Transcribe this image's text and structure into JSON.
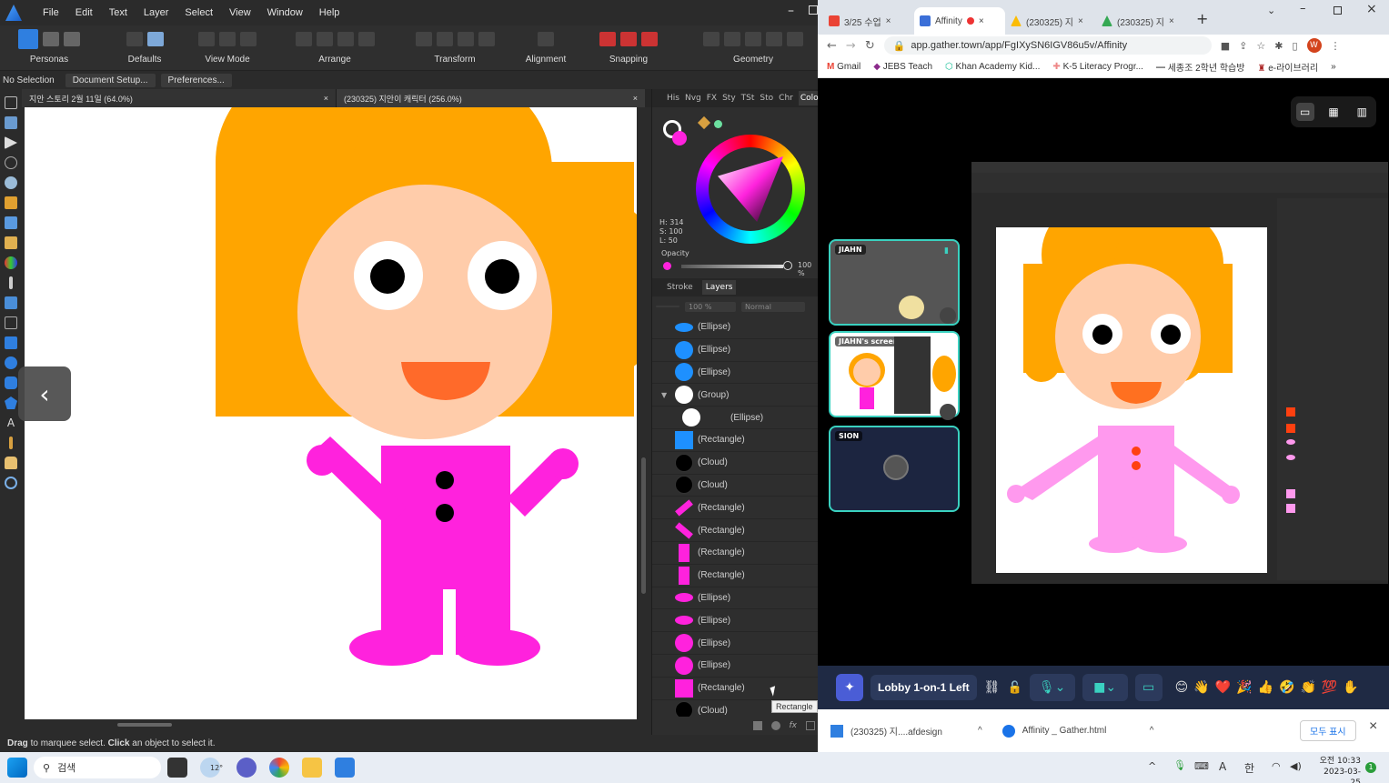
{
  "affinity": {
    "menu": [
      "File",
      "Edit",
      "Text",
      "Layer",
      "Select",
      "View",
      "Window",
      "Help"
    ],
    "toolbar": {
      "personas": "Personas",
      "defaults": "Defaults",
      "view_mode": "View Mode",
      "arrange": "Arrange",
      "transform": "Transform",
      "alignment": "Alignment",
      "snapping": "Snapping",
      "geometry": "Geometry"
    },
    "context": {
      "selection": "No Selection",
      "doc_setup": "Document Setup...",
      "preferences": "Preferences..."
    },
    "doc_tabs": [
      {
        "label": "지안 스토리 2월 11일 (64.0%)"
      },
      {
        "label": "(230325) 지안이 캐릭터 (256.0%)"
      }
    ],
    "close_glyph": "×",
    "panel_tabs": [
      "His",
      "Nvg",
      "FX",
      "Sty",
      "TSt",
      "Sto",
      "Chr",
      "Colo"
    ],
    "color": {
      "h": "H: 314",
      "s": "S: 100",
      "l": "L: 50",
      "opacity_label": "Opacity",
      "opacity_value": "100 %",
      "accent": "#ff00dd"
    },
    "layer_tabs": [
      "Stroke",
      "Layers"
    ],
    "layer_opacity": "100 %",
    "blend": "Normal",
    "layers": [
      {
        "name": "(Ellipse)",
        "color": "#1e90ff",
        "shape": "ellipse-h"
      },
      {
        "name": "(Ellipse)",
        "color": "#1e90ff",
        "shape": "circle"
      },
      {
        "name": "(Ellipse)",
        "color": "#1e90ff",
        "shape": "circle"
      },
      {
        "name": "(Group)",
        "color": "#ffffff",
        "shape": "circle",
        "caret": "▼"
      },
      {
        "name": "(Ellipse)",
        "color": "#ffffff",
        "shape": "circle",
        "child": true
      },
      {
        "name": "(Rectangle)",
        "color": "#1e90ff",
        "shape": "square"
      },
      {
        "name": "(Cloud)",
        "color": "#000000",
        "shape": "circle"
      },
      {
        "name": "(Cloud)",
        "color": "#000000",
        "shape": "circle"
      },
      {
        "name": "(Rectangle)",
        "color": "#ff22dd",
        "shape": "diag1"
      },
      {
        "name": "(Rectangle)",
        "color": "#ff22dd",
        "shape": "diag2"
      },
      {
        "name": "(Rectangle)",
        "color": "#ff22dd",
        "shape": "bar"
      },
      {
        "name": "(Rectangle)",
        "color": "#ff22dd",
        "shape": "bar"
      },
      {
        "name": "(Ellipse)",
        "color": "#ff22dd",
        "shape": "ellipse-h"
      },
      {
        "name": "(Ellipse)",
        "color": "#ff22dd",
        "shape": "ellipse-h"
      },
      {
        "name": "(Ellipse)",
        "color": "#ff22dd",
        "shape": "circle"
      },
      {
        "name": "(Ellipse)",
        "color": "#ff22dd",
        "shape": "circle"
      },
      {
        "name": "(Rectangle)",
        "color": "#ff22dd",
        "shape": "square"
      },
      {
        "name": "(Cloud)",
        "color": "#000000",
        "shape": "circle"
      }
    ],
    "tooltip": "Rectangle",
    "status": {
      "drag": "Drag",
      "drag_rest": " to marquee select. ",
      "click": "Click",
      "click_rest": " an object to select it."
    }
  },
  "chrome": {
    "tabs": [
      {
        "label": "3/25 수업",
        "fav": "#ea4335"
      },
      {
        "label": "Affinity",
        "fav": "#3b6fd8",
        "active": true
      },
      {
        "label": "(230325) 지",
        "fav": "#fbbc05"
      },
      {
        "label": "(230325) 지",
        "fav": "#34a853"
      }
    ],
    "new_tab": "+",
    "url": "app.gather.town/app/FgIXySN6IGV86u5v/Affinity",
    "avatar": "W",
    "bookmarks": [
      "Gmail",
      "JEBS Teach",
      "Khan Academy Kid...",
      "K-5 Literacy Progr...",
      "세종조 2학년 학습방",
      "e-라이브러리"
    ],
    "bookmark_more": "»"
  },
  "gather": {
    "participants": [
      {
        "name": "JIAHN"
      },
      {
        "name": "JIAHN's screen"
      },
      {
        "name": "SION"
      }
    ],
    "room": "Lobby 1-on-1 Left",
    "emojis": [
      "😊",
      "👋",
      "❤️",
      "🎉",
      "👍",
      "🤣",
      "👏",
      "💯",
      "✋"
    ]
  },
  "downloads": {
    "items": [
      "(230325) 지....afdesign",
      "Affinity _ Gather.html"
    ],
    "show_all": "모두 표시",
    "close": "×"
  },
  "taskbar": {
    "search": "검색",
    "weather": "12°",
    "ime": "한",
    "lang": "A",
    "time": "오전 10:33",
    "date": "2023-03-25",
    "badge": "1"
  }
}
